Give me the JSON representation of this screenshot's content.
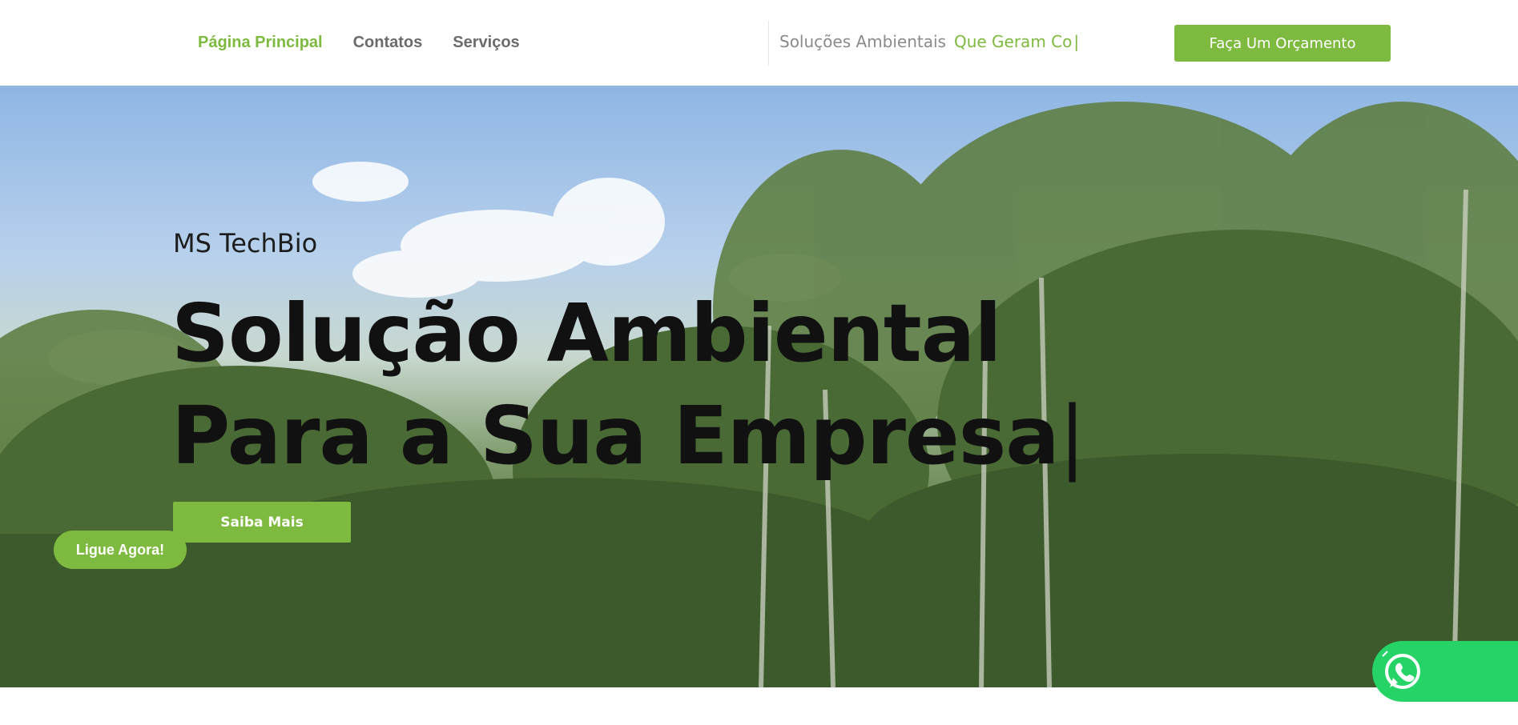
{
  "header": {
    "nav": [
      {
        "label": "Página Principal",
        "active": true
      },
      {
        "label": "Contatos",
        "active": false
      },
      {
        "label": "Serviços",
        "active": false
      }
    ],
    "tagline": {
      "muted": "Soluções Ambientais",
      "accent": "Que Geram Co",
      "cursor": "|"
    },
    "quote_button": "Faça Um Orçamento"
  },
  "hero": {
    "kicker": "MS TechBio",
    "headline_line1": "Solução Ambiental",
    "headline_line2": "Para a Sua Empresa",
    "cursor": "|",
    "cta_button": "Saiba Mais"
  },
  "floating": {
    "call_button": "Ligue Agora!",
    "whatsapp_icon": "whatsapp-icon"
  },
  "colors": {
    "accent": "#7dba3f",
    "whatsapp": "#25d366",
    "nav_text": "#6b6b6b",
    "headline": "#111111"
  }
}
